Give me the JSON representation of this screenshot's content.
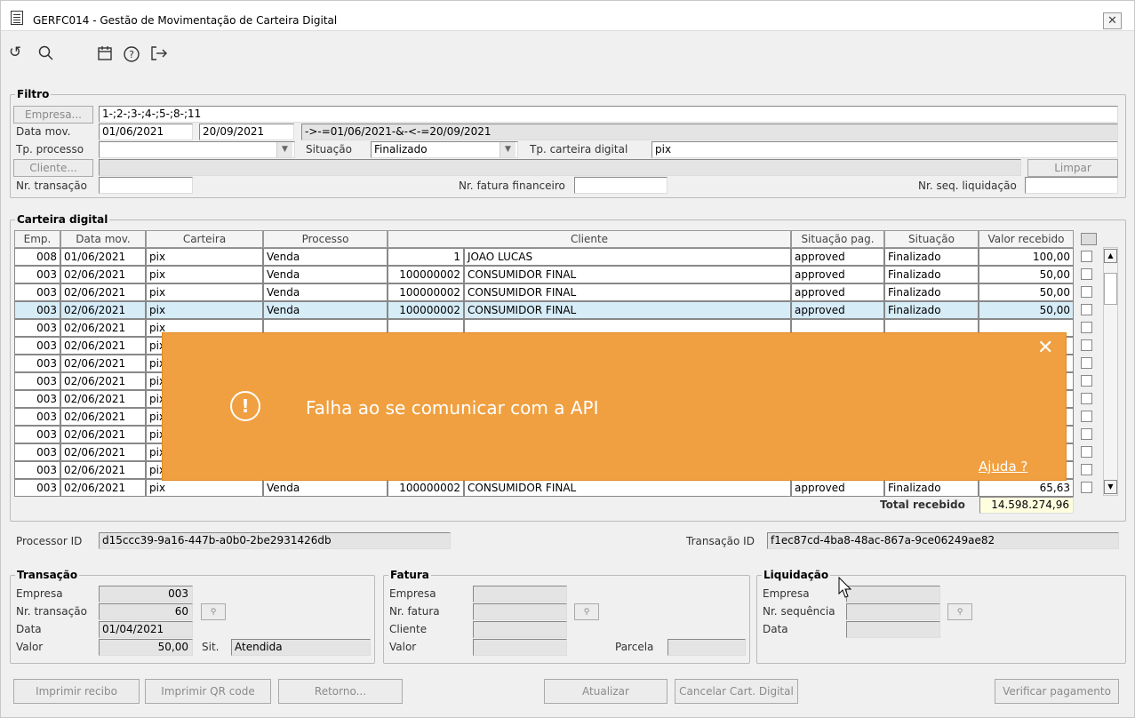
{
  "window": {
    "title": "GERFC014 - Gestão de Movimentação de Carteira Digital",
    "close": "✕"
  },
  "toolbar": {
    "undo": "↺",
    "search": "🔍",
    "calendar": "📅",
    "help": "?",
    "exit": "⇥"
  },
  "filtro": {
    "label": "Filtro",
    "empresa_btn": "Empresa...",
    "empresa_value": "1-;2-;3-;4-;5-;8-;11",
    "data_label": "Data mov.",
    "data_from": "01/06/2021",
    "data_to": "20/09/2021",
    "data_expr": "->-=01/06/2021-&-<-=20/09/2021",
    "tp_processo_label": "Tp. processo",
    "tp_processo_value": "",
    "situacao_label": "Situação",
    "situacao_value": "Finalizado",
    "tp_carteira_label": "Tp. carteira digital",
    "tp_carteira_value": "pix",
    "cliente_btn": "Cliente...",
    "limpar_btn": "Limpar",
    "nr_transacao_label": "Nr. transação",
    "nr_fatura_label": "Nr. fatura financeiro",
    "nr_seq_label": "Nr. seq. liquidação"
  },
  "carteira": {
    "label": "Carteira digital",
    "headers": [
      "Emp.",
      "Data mov.",
      "Carteira",
      "Processo",
      "Cliente",
      "Situação pag.",
      "Situação",
      "Valor recebido"
    ],
    "rows": [
      {
        "emp": "008",
        "data": "01/06/2021",
        "carteira": "pix",
        "processo": "Venda",
        "cod": "1",
        "cliente": "JOAO LUCAS",
        "sitpag": "approved",
        "sit": "Finalizado",
        "valor": "100,00"
      },
      {
        "emp": "003",
        "data": "02/06/2021",
        "carteira": "pix",
        "processo": "Venda",
        "cod": "100000002",
        "cliente": "CONSUMIDOR FINAL",
        "sitpag": "approved",
        "sit": "Finalizado",
        "valor": "50,00"
      },
      {
        "emp": "003",
        "data": "02/06/2021",
        "carteira": "pix",
        "processo": "Venda",
        "cod": "100000002",
        "cliente": "CONSUMIDOR FINAL",
        "sitpag": "approved",
        "sit": "Finalizado",
        "valor": "50,00"
      },
      {
        "emp": "003",
        "data": "02/06/2021",
        "carteira": "pix",
        "processo": "Venda",
        "cod": "100000002",
        "cliente": "CONSUMIDOR FINAL",
        "sitpag": "approved",
        "sit": "Finalizado",
        "valor": "50,00"
      },
      {
        "emp": "003",
        "data": "02/06/2021",
        "carteira": "pix",
        "processo": "",
        "cod": "",
        "cliente": "",
        "sitpag": "",
        "sit": "",
        "valor": ""
      },
      {
        "emp": "003",
        "data": "02/06/2021",
        "carteira": "pix",
        "processo": "",
        "cod": "",
        "cliente": "",
        "sitpag": "",
        "sit": "",
        "valor": ""
      },
      {
        "emp": "003",
        "data": "02/06/2021",
        "carteira": "pix",
        "processo": "",
        "cod": "",
        "cliente": "",
        "sitpag": "",
        "sit": "",
        "valor": ""
      },
      {
        "emp": "003",
        "data": "02/06/2021",
        "carteira": "pix",
        "processo": "",
        "cod": "",
        "cliente": "",
        "sitpag": "",
        "sit": "",
        "valor": ""
      },
      {
        "emp": "003",
        "data": "02/06/2021",
        "carteira": "pix",
        "processo": "",
        "cod": "",
        "cliente": "",
        "sitpag": "",
        "sit": "",
        "valor": ""
      },
      {
        "emp": "003",
        "data": "02/06/2021",
        "carteira": "pix",
        "processo": "",
        "cod": "",
        "cliente": "",
        "sitpag": "",
        "sit": "",
        "valor": ""
      },
      {
        "emp": "003",
        "data": "02/06/2021",
        "carteira": "pix",
        "processo": "",
        "cod": "",
        "cliente": "",
        "sitpag": "",
        "sit": "",
        "valor": ""
      },
      {
        "emp": "003",
        "data": "02/06/2021",
        "carteira": "pix",
        "processo": "",
        "cod": "",
        "cliente": "",
        "sitpag": "",
        "sit": "",
        "valor": ""
      },
      {
        "emp": "003",
        "data": "02/06/2021",
        "carteira": "pix",
        "processo": "",
        "cod": "",
        "cliente": "",
        "sitpag": "",
        "sit": "",
        "valor": ""
      },
      {
        "emp": "003",
        "data": "02/06/2021",
        "carteira": "pix",
        "processo": "Venda",
        "cod": "100000002",
        "cliente": "CONSUMIDOR FINAL",
        "sitpag": "approved",
        "sit": "Finalizado",
        "valor": "65,63"
      }
    ],
    "total_label": "Total recebido",
    "total_value": "14.598.274,96"
  },
  "ids": {
    "processor_label": "Processor ID",
    "processor_value": "d15ccc39-9a16-447b-a0b0-2be2931426db",
    "transacao_label": "Transação ID",
    "transacao_value": "f1ec87cd-4ba8-48ac-867a-9ce06249ae82"
  },
  "transacao": {
    "label": "Transação",
    "empresa_label": "Empresa",
    "empresa": "003",
    "nr_label": "Nr. transação",
    "nr": "60",
    "data_label": "Data",
    "data": "01/04/2021",
    "valor_label": "Valor",
    "valor": "50,00",
    "sit_label": "Sit.",
    "sit": "Atendida"
  },
  "fatura": {
    "label": "Fatura",
    "empresa_label": "Empresa",
    "nr_label": "Nr. fatura",
    "cliente_label": "Cliente",
    "valor_label": "Valor",
    "parcela_label": "Parcela"
  },
  "liquidacao": {
    "label": "Liquidação",
    "empresa_label": "Empresa",
    "nr_label": "Nr. sequência",
    "data_label": "Data"
  },
  "buttons": {
    "imprimir_recibo": "Imprimir recibo",
    "imprimir_qr": "Imprimir QR code",
    "retorno": "Retorno...",
    "atualizar": "Atualizar",
    "cancelar": "Cancelar Cart. Digital",
    "verificar": "Verificar pagamento"
  },
  "toast": {
    "message": "Falha ao se comunicar com a API",
    "help": "Ajuda ?",
    "close": "✕",
    "icon": "!"
  }
}
